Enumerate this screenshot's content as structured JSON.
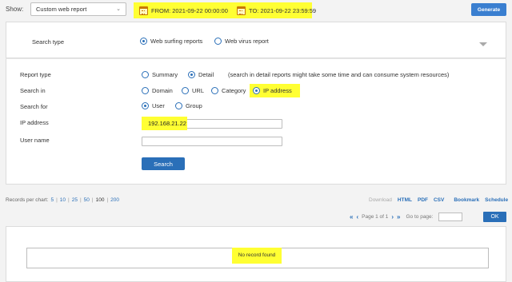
{
  "toolbar": {
    "show_label": "Show:",
    "report_select": "Custom web report",
    "from_label": "FROM: 2021-09-22 00:00:00",
    "to_label": "TO: 2021-09-22 23:59:59",
    "generate_label": "Generate",
    "highlight_color": "#ffff33",
    "accent_color": "#2a6fb8"
  },
  "search_type": {
    "label": "Search type",
    "options": [
      "Web surfing reports",
      "Web virus report"
    ],
    "selected": "Web surfing reports"
  },
  "form": {
    "report_type": {
      "label": "Report type",
      "summary": "Summary",
      "detail": "Detail",
      "note": "(search in detail reports might take some time and can consume system resources)",
      "selected": "Detail"
    },
    "search_in": {
      "label": "Search in",
      "options": [
        "Domain",
        "URL",
        "Category",
        "IP address"
      ],
      "selected": "IP address"
    },
    "search_for": {
      "label": "Search for",
      "options": [
        "User",
        "Group"
      ],
      "selected": "User"
    },
    "ip_address": {
      "label": "IP address",
      "value": "192.168.21.22"
    },
    "user_name": {
      "label": "User name",
      "value": ""
    },
    "search_button": "Search"
  },
  "records": {
    "label": "Records per chart:",
    "options": [
      "5",
      "10",
      "25",
      "50",
      "100",
      "200"
    ],
    "selected": "100"
  },
  "exports": {
    "download": "Download",
    "html": "HTML",
    "pdf": "PDF",
    "csv": "CSV",
    "bookmark": "Bookmark",
    "schedule": "Schedule"
  },
  "pager": {
    "page_text": "Page 1 of 1",
    "goto_label": "Go to page:",
    "ok_label": "OK"
  },
  "results": {
    "empty_text": "No record found"
  }
}
